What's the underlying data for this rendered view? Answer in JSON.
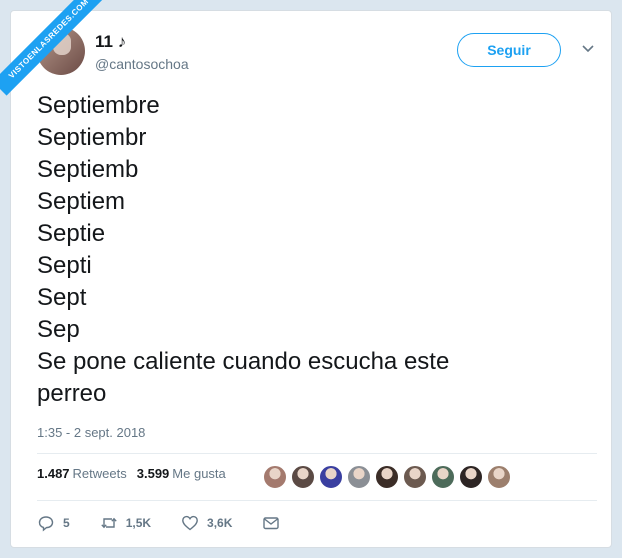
{
  "watermark": "VISTOENLASREDES.COM",
  "user": {
    "name": "11 ♪",
    "handle": "@cantosochoa"
  },
  "follow_label": "Seguir",
  "tweet_lines": [
    "Septiembre",
    "Septiembr",
    "Septiemb",
    "Septiem",
    "Septie",
    "Septi",
    "Sept",
    "Sep",
    "Se pone caliente cuando escucha este",
    "perreo"
  ],
  "timestamp": "1:35 - 2 sept. 2018",
  "stats": {
    "retweets_count": "1.487",
    "retweets_label": "Retweets",
    "likes_count": "3.599",
    "likes_label": "Me gusta"
  },
  "liker_avatar_colors": [
    "#a47a6e",
    "#5b4a44",
    "#3a3fa0",
    "#8b8f95",
    "#3b2d27",
    "#6c5a50",
    "#4d6b5a",
    "#2d2524",
    "#9c7f6d"
  ],
  "actions": {
    "replies": "5",
    "retweets": "1,5K",
    "likes": "3,6K"
  },
  "colors": {
    "accent": "#1da1f2",
    "text": "#14171a",
    "muted": "#657786"
  }
}
